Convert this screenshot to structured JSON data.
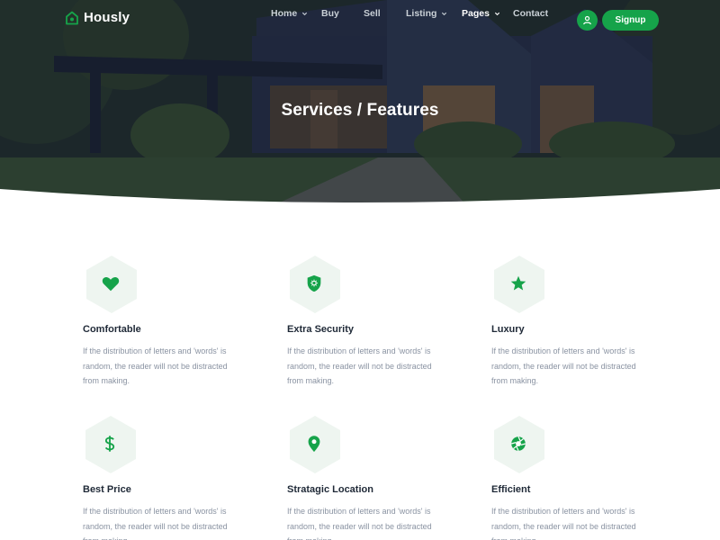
{
  "brand": {
    "name": "Hously",
    "accent": "#16a34a"
  },
  "nav": {
    "items": [
      {
        "label": "Home",
        "has_dropdown": true,
        "active": false
      },
      {
        "label": "Buy",
        "has_dropdown": false,
        "active": false
      },
      {
        "label": "Sell",
        "has_dropdown": false,
        "active": false
      },
      {
        "label": "Listing",
        "has_dropdown": true,
        "active": false
      },
      {
        "label": "Pages",
        "has_dropdown": true,
        "active": true
      },
      {
        "label": "Contact",
        "has_dropdown": false,
        "active": false
      }
    ],
    "user_icon": "user-icon",
    "signup_label": "Signup"
  },
  "hero": {
    "title": "Services / Features"
  },
  "features": [
    {
      "title": "Comfortable",
      "icon": "heart-icon",
      "description": "If the distribution of letters and 'words' is random, the reader will not be distracted from making."
    },
    {
      "title": "Extra Security",
      "icon": "shield-icon",
      "description": "If the distribution of letters and 'words' is random, the reader will not be distracted from making."
    },
    {
      "title": "Luxury",
      "icon": "star-icon",
      "description": "If the distribution of letters and 'words' is random, the reader will not be distracted from making."
    },
    {
      "title": "Best Price",
      "icon": "dollar-icon",
      "description": "If the distribution of letters and 'words' is random, the reader will not be distracted from making."
    },
    {
      "title": "Stratagic Location",
      "icon": "map-pin-icon",
      "description": "If the distribution of letters and 'words' is random, the reader will not be distracted from making."
    },
    {
      "title": "Efficient",
      "icon": "aperture-icon",
      "description": "If the distribution of letters and 'words' is random, the reader will not be distracted from making."
    }
  ]
}
